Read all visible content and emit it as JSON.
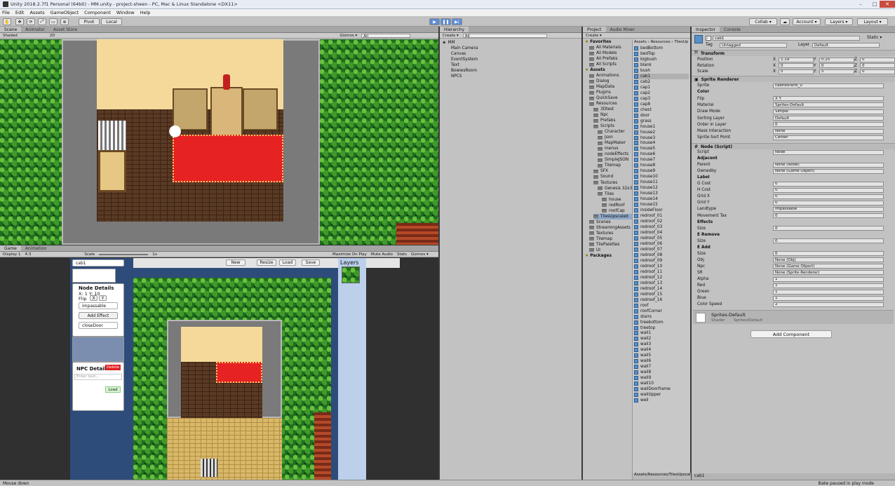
{
  "window": {
    "title": "Unity 2018.2.7f1 Personal (64bit) - MM.unity - project-sheen - PC, Mac & Linux Standalone <DX11>",
    "minimize": "–",
    "maximize": "□",
    "close": "✕"
  },
  "menu": [
    "File",
    "Edit",
    "Assets",
    "GameObject",
    "Component",
    "Window",
    "Help"
  ],
  "toolbar": {
    "pivot": "Pivot",
    "local": "Local",
    "play": "▶",
    "pause": "❚❚",
    "step": "▶|",
    "collab": "Collab ▾",
    "account": "Account ▾",
    "layers": "Layers ▾",
    "layout": "Layout ▾"
  },
  "scene": {
    "tabs": [
      "Scene",
      "Animator",
      "Asset Store"
    ],
    "shading": "Shaded",
    "mode2d": "2D",
    "gizmos": "Gizmos ▾",
    "search": "All"
  },
  "game": {
    "tabs": [
      "Game",
      "Animation"
    ],
    "display": "Display 1",
    "aspect": "4:3",
    "scale_label": "Scale",
    "scale_value": "1x",
    "maximize": "Maximize On Play",
    "mute": "Mute Audio",
    "stats": "Stats",
    "gizmos": "Gizmos ▾"
  },
  "game_ui": {
    "dropdown": "cab1",
    "buttons": [
      "New",
      "Resize",
      "Load",
      "Save"
    ],
    "layers_title": "Layers",
    "node_details_title": "Node Details",
    "coords": "X: 1  Y: 10",
    "flip_label": "Flip",
    "flip_x": "X",
    "flip_y": "Y",
    "landtype": "impassable",
    "add_effect": "Add Effect",
    "effect": "closeDoor",
    "npc_title": "NPC Details",
    "npc_delete": "Delete",
    "npc_placeholder": "Enter text...",
    "npc_load": "Load"
  },
  "hierarchy": {
    "tab": "Hierarchy",
    "create": "Create ▾",
    "search": "All",
    "scene": "MM",
    "items": [
      "Main Camera",
      "Canvas",
      "EventSystem",
      "Text",
      "BowiesRoom",
      "NPCS"
    ]
  },
  "project": {
    "tabs": [
      "Project",
      "Audio Mixer"
    ],
    "create": "Create ▾",
    "tree": [
      {
        "label": "Favorites",
        "bold": true,
        "depth": 0
      },
      {
        "label": "All Materials",
        "depth": 1
      },
      {
        "label": "All Models",
        "depth": 1
      },
      {
        "label": "All Prefabs",
        "depth": 1
      },
      {
        "label": "All Scripts",
        "depth": 1
      },
      {
        "label": "Assets",
        "bold": true,
        "depth": 0
      },
      {
        "label": "Animations",
        "depth": 1
      },
      {
        "label": "Dialog",
        "depth": 1
      },
      {
        "label": "MapData",
        "depth": 1
      },
      {
        "label": "Plugins",
        "depth": 1
      },
      {
        "label": "QuickSave",
        "depth": 1
      },
      {
        "label": "Resources",
        "depth": 1
      },
      {
        "label": "3Dtest",
        "depth": 2
      },
      {
        "label": "Npc",
        "depth": 2
      },
      {
        "label": "Prefabs",
        "depth": 2
      },
      {
        "label": "Scripts",
        "depth": 2
      },
      {
        "label": "Character",
        "depth": 3
      },
      {
        "label": "Json",
        "depth": 3
      },
      {
        "label": "MapMaker",
        "depth": 3
      },
      {
        "label": "menus",
        "depth": 3
      },
      {
        "label": "nodeEffects",
        "depth": 3
      },
      {
        "label": "SimpleJSON",
        "depth": 3
      },
      {
        "label": "Tilemap",
        "depth": 3
      },
      {
        "label": "SFX",
        "depth": 2
      },
      {
        "label": "Sound",
        "depth": 2
      },
      {
        "label": "Textures",
        "depth": 2
      },
      {
        "label": "Genesis 32x32",
        "depth": 3
      },
      {
        "label": "Tiles",
        "depth": 3
      },
      {
        "label": "house",
        "depth": 4
      },
      {
        "label": "redRoof",
        "depth": 4
      },
      {
        "label": "roofCap",
        "depth": 4
      },
      {
        "label": "TilesUpscaled",
        "depth": 2,
        "sel": true
      },
      {
        "label": "Scenes",
        "depth": 1
      },
      {
        "label": "StreamingAssets",
        "depth": 1
      },
      {
        "label": "Textures",
        "depth": 1
      },
      {
        "label": "Tilemap",
        "depth": 1
      },
      {
        "label": "TilePalettes",
        "depth": 1
      },
      {
        "label": "UI",
        "depth": 1
      },
      {
        "label": "Packages",
        "bold": true,
        "depth": 0
      }
    ],
    "breadcrumb": "Assets › Resources › TilesUp",
    "files": [
      "bedBottom",
      "bedTop",
      "bigbush",
      "blank",
      "bush",
      "cab1",
      "cab2",
      "cap1",
      "cap2",
      "cap3",
      "cap8",
      "chest",
      "door",
      "grass",
      "house1",
      "house2",
      "house3",
      "house4",
      "house5",
      "house6",
      "house7",
      "house8",
      "house9",
      "house10",
      "house11",
      "house12",
      "house13",
      "house14",
      "house15",
      "insideFloor",
      "redroof_01",
      "redroof_02",
      "redroof_03",
      "redroof_04",
      "redroof_05",
      "redroof_06",
      "redroof_07",
      "redroof_08",
      "redroof_09",
      "redroof_10",
      "redroof_11",
      "redroof_12",
      "redroof_13",
      "redroof_14",
      "redroof_15",
      "redroof_16",
      "roof",
      "roofCorner",
      "stairs",
      "treebottom",
      "treetop",
      "wall1",
      "wall2",
      "wall3",
      "wall4",
      "wall5",
      "wall6",
      "wall7",
      "wall8",
      "wall9",
      "wall10",
      "wallDoorframe",
      "wallUpper",
      "well"
    ],
    "selected_file": "cab1",
    "footer": "Assets/Resources/TilesUpscaled/cab1.png"
  },
  "inspector": {
    "tabs": [
      "Inspector",
      "Console"
    ],
    "name": "cab1",
    "static": "Static ▾",
    "tag_label": "Tag",
    "tag": "Untagged",
    "layer_label": "Layer",
    "layer": "Default",
    "transform": {
      "title": "Transform",
      "rows": [
        [
          "Position",
          "1.19",
          "0.25",
          "0"
        ],
        [
          "Rotation",
          "0",
          "0",
          "0"
        ],
        [
          "Scale",
          "5",
          "5",
          "0"
        ]
      ]
    },
    "sprite_renderer": {
      "title": "Sprite Renderer",
      "rows": [
        [
          "Sprite",
          "cabnetParts_0"
        ],
        [
          "Color",
          ""
        ],
        [
          "Flip",
          "X  Y"
        ],
        [
          "Material",
          "Sprites-Default"
        ],
        [
          "Draw Mode",
          "Simple"
        ],
        [
          "Sorting Layer",
          "Default"
        ],
        [
          "Order in Layer",
          "0"
        ],
        [
          "Mask Interaction",
          "None"
        ],
        [
          "Sprite Sort Point",
          "Center"
        ]
      ]
    },
    "node": {
      "title": "Node (Script)",
      "rows": [
        [
          "Script",
          "Node"
        ],
        [
          "Adjacent",
          ""
        ],
        [
          "Parent",
          "None (Node)"
        ],
        [
          "Ownedby",
          "None (Game Object)"
        ],
        [
          "Label",
          ""
        ],
        [
          "G Cost",
          "0"
        ],
        [
          "H Cost",
          "0"
        ],
        [
          "Grid X",
          "0"
        ],
        [
          "Grid Y",
          "0"
        ],
        [
          "Landtype",
          "impassable"
        ],
        [
          "Movement Tax",
          "0"
        ],
        [
          "Effects",
          ""
        ],
        [
          "Size",
          "0"
        ],
        [
          "E Remove",
          ""
        ],
        [
          "Size",
          "0"
        ],
        [
          "E Add",
          ""
        ],
        [
          "Size",
          "0"
        ],
        [
          "Obj",
          "None (Obj)"
        ],
        [
          "Npc",
          "None (Game Object)"
        ],
        [
          "SR",
          "None (Sprite Renderer)"
        ],
        [
          "Alpha",
          "1"
        ],
        [
          "Red",
          "1"
        ],
        [
          "Green",
          "1"
        ],
        [
          "Blue",
          "1"
        ],
        [
          "Color Speed",
          "2"
        ]
      ]
    },
    "material": {
      "name": "Sprites-Default",
      "shader_label": "Shader",
      "shader": "Sprites/Default"
    },
    "add_component": "Add Component",
    "footer": "cab1"
  },
  "status": {
    "left": "Mouse down",
    "right": "Bake paused in play mode"
  }
}
